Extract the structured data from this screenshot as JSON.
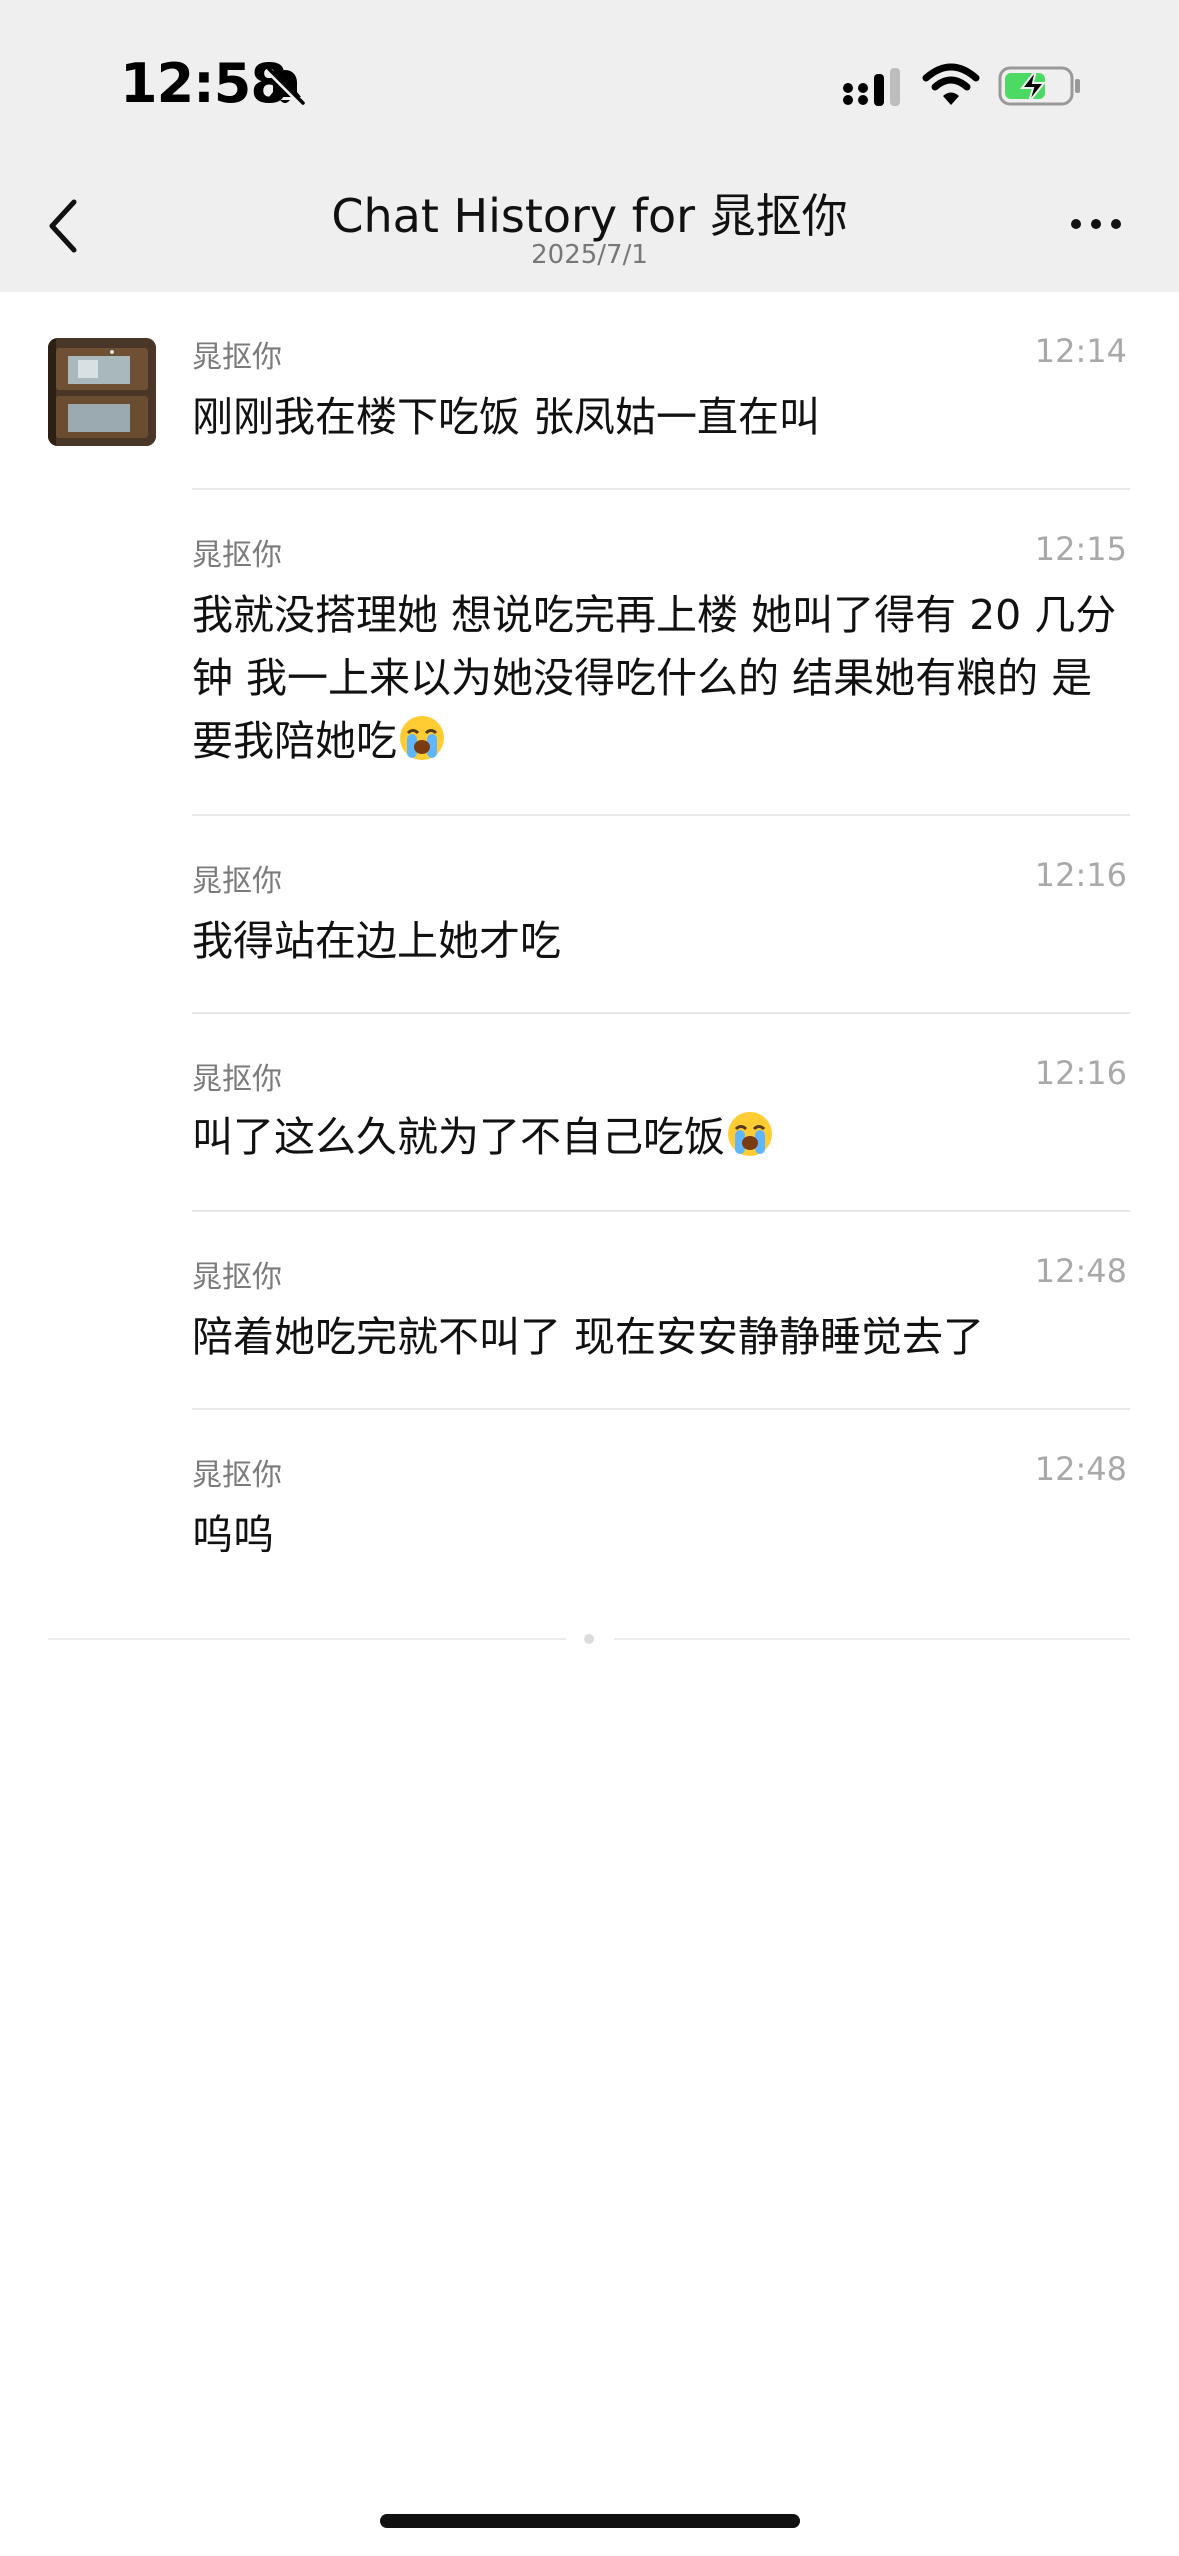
{
  "status_bar": {
    "time": "12:58",
    "icons": [
      "bell-muted-icon",
      "cellular-signal-icon",
      "wifi-icon",
      "battery-charging-icon"
    ],
    "battery_color": "#4cd964"
  },
  "nav": {
    "title": "Chat History for 晁抠你",
    "subtitle": "2025/7/1",
    "back_icon": "chevron-left-icon",
    "more_icon": "more-icon"
  },
  "messages": [
    {
      "sender": "晁抠你",
      "time": "12:14",
      "text": "刚刚我在楼下吃饭 张凤姑一直在叫",
      "emoji": ""
    },
    {
      "sender": "晁抠你",
      "time": "12:15",
      "text": "我就没搭理她 想说吃完再上楼 她叫了得有 20 几分钟 我一上来以为她没得吃什么的 结果她有粮的 是要我陪她吃",
      "emoji": "😭"
    },
    {
      "sender": "晁抠你",
      "time": "12:16",
      "text": "我得站在边上她才吃",
      "emoji": ""
    },
    {
      "sender": "晁抠你",
      "time": "12:16",
      "text": "叫了这么久就为了不自己吃饭",
      "emoji": "😭"
    },
    {
      "sender": "晁抠你",
      "time": "12:48",
      "text": "陪着她吃完就不叫了 现在安安静静睡觉去了",
      "emoji": ""
    },
    {
      "sender": "晁抠你",
      "time": "12:48",
      "text": "呜呜",
      "emoji": ""
    }
  ],
  "colors": {
    "topbar_bg": "#efefef",
    "sender": "#7b7b7b",
    "timestamp": "#a9a9a9",
    "separator": "#e7e7e7"
  }
}
